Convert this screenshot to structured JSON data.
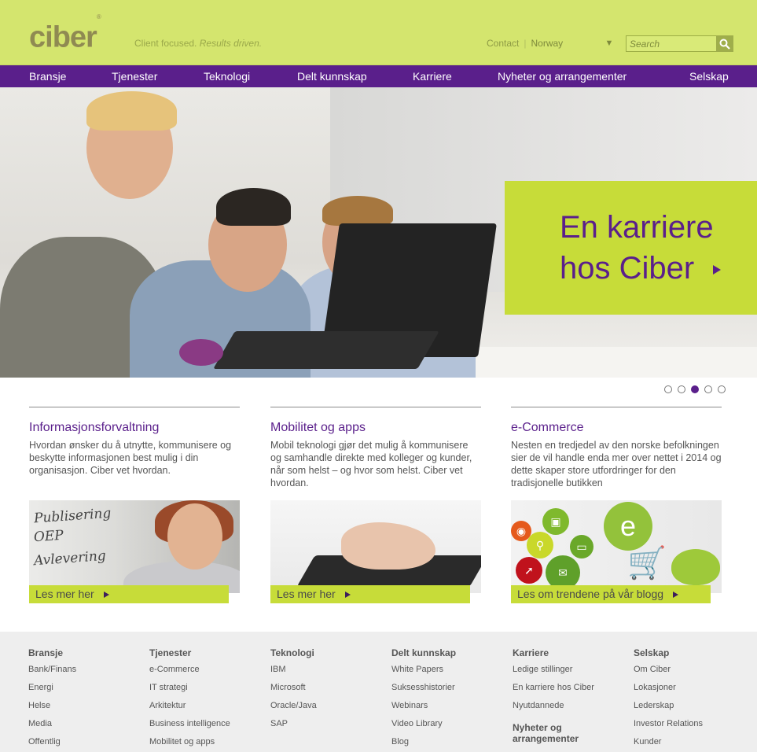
{
  "header": {
    "logo": "ciber",
    "logo_mark": "®",
    "tagline_a": "Client focused.",
    "tagline_b": "Results driven.",
    "contact": "Contact",
    "separator": "|",
    "country": "Norway",
    "search_placeholder": "Search"
  },
  "nav": [
    "Bransje",
    "Tjenester",
    "Teknologi",
    "Delt kunnskap",
    "Karriere",
    "Nyheter og arrangementer",
    "Selskap"
  ],
  "hero": {
    "promo_line1": "En karriere",
    "promo_line2": "hos Ciber",
    "slide_count": 5,
    "active_slide": 3
  },
  "columns": [
    {
      "title": "Informasjonsforvaltning",
      "text": "Hvordan ønsker du å utnytte, kommunisere og beskytte informasjonen best mulig i din organisasjon. Ciber vet hvordan.",
      "cta": "Les mer her",
      "handwriting": [
        "Publisering",
        "OEP",
        "Avlevering"
      ]
    },
    {
      "title": "Mobilitet og apps",
      "text": "Mobil teknologi gjør det mulig å kommunisere og samhandle direkte med kolleger og kunder, når som helst – og hvor som helst. Ciber vet hvordan.",
      "cta": "Les mer her"
    },
    {
      "title": "e-Commerce",
      "text": "Nesten en tredjedel av den norske befolkningen sier de vil handle enda mer over nettet i 2014 og dette skaper store utfordringer for den tradisjonelle butikken",
      "cta": "Les om trendene på vår blogg"
    }
  ],
  "footer": {
    "bransje": {
      "title": "Bransje",
      "links": [
        "Bank/Finans",
        "Energi",
        "Helse",
        "Media",
        "Offentlig"
      ]
    },
    "tjenester": {
      "title": "Tjenester",
      "links": [
        "e-Commerce",
        "IT strategi",
        "Arkitektur",
        "Business intelligence",
        "Mobilitet og apps"
      ]
    },
    "teknologi": {
      "title": "Teknologi",
      "links": [
        "IBM",
        "Microsoft",
        "Oracle/Java",
        "SAP"
      ]
    },
    "delt": {
      "title": "Delt kunnskap",
      "links": [
        "White Papers",
        "Suksesshistorier",
        "Webinars",
        "Video Library",
        "Blog"
      ]
    },
    "karriere": {
      "title": "Karriere",
      "links": [
        "Ledige stillinger",
        "En karriere hos Ciber",
        "Nyutdannede"
      ],
      "sub_title": "Nyheter og arrangementer"
    },
    "selskap": {
      "title": "Selskap",
      "links": [
        "Om Ciber",
        "Lokasjoner",
        "Lederskap",
        "Investor Relations",
        "Kunder"
      ]
    }
  },
  "colors": {
    "brand_green": "#d4e56e",
    "accent_green": "#c7dc39",
    "brand_purple": "#5a1f8b"
  }
}
